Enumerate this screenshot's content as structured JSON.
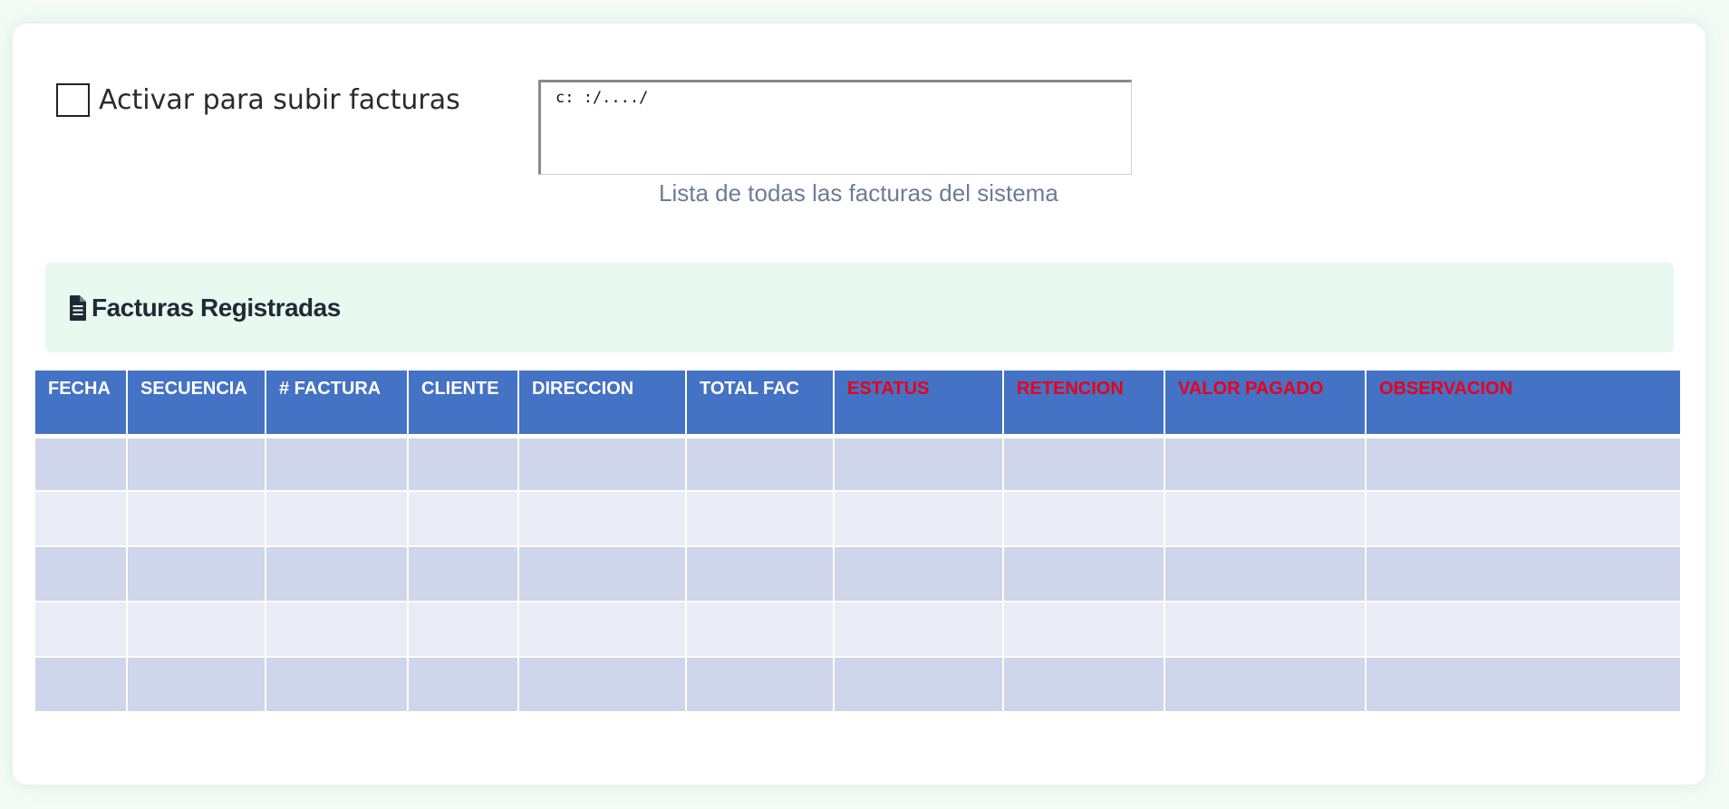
{
  "upload": {
    "checkbox_label": "Activar para subir facturas",
    "checked": false,
    "path_value": "c: :/..../",
    "caption": "Lista de todas las facturas del sistema"
  },
  "section": {
    "icon": "file-document-icon",
    "title": "Facturas Registradas"
  },
  "table": {
    "columns": [
      {
        "label": "FECHA",
        "highlight": false
      },
      {
        "label": "SECUENCIA",
        "highlight": false
      },
      {
        "label": "# FACTURA",
        "highlight": false
      },
      {
        "label": "CLIENTE",
        "highlight": false
      },
      {
        "label": "DIRECCION",
        "highlight": false
      },
      {
        "label": "TOTAL FAC",
        "highlight": false
      },
      {
        "label": "ESTATUS",
        "highlight": true
      },
      {
        "label": "RETENCION",
        "highlight": true
      },
      {
        "label": "VALOR PAGADO",
        "highlight": true
      },
      {
        "label": "OBSERVACION",
        "highlight": true
      }
    ],
    "rows": [
      [
        "",
        "",
        "",
        "",
        "",
        "",
        "",
        "",
        "",
        ""
      ],
      [
        "",
        "",
        "",
        "",
        "",
        "",
        "",
        "",
        "",
        ""
      ],
      [
        "",
        "",
        "",
        "",
        "",
        "",
        "",
        "",
        "",
        ""
      ],
      [
        "",
        "",
        "",
        "",
        "",
        "",
        "",
        "",
        "",
        ""
      ],
      [
        "",
        "",
        "",
        "",
        "",
        "",
        "",
        "",
        "",
        ""
      ]
    ]
  },
  "colors": {
    "header_bg": "#4472c4",
    "header_text": "#ffffff",
    "highlight_text": "#e8001c",
    "row_odd": "#cfd5ea",
    "row_even": "#e9ebf5",
    "section_bg": "#e8f9ef"
  }
}
